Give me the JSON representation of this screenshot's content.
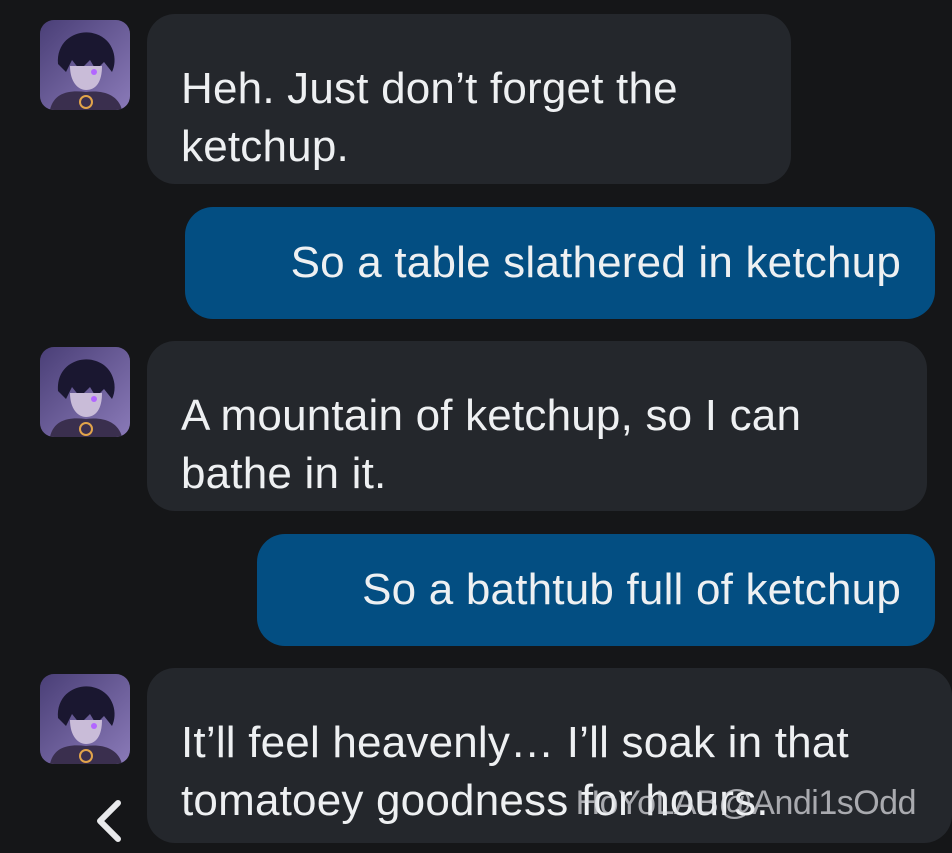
{
  "messages": [
    {
      "sender": "bot",
      "text": "Heh. Just don’t forget the ketchup."
    },
    {
      "sender": "user",
      "text": "So a table slathered in ketchup"
    },
    {
      "sender": "bot",
      "text": "A mountain of ketchup, so I can bathe in it."
    },
    {
      "sender": "user",
      "text": "So a bathtub full of ketchup"
    },
    {
      "sender": "bot",
      "text": "It’ll feel heavenly… I’ll soak in that tomatoey goodness for hours."
    }
  ],
  "watermark": "HoYoLAB@Andi1sOdd",
  "icons": {
    "avatar": "character-avatar",
    "back": "chevron-left-icon"
  },
  "colors": {
    "background": "#151618",
    "incoming_bubble": "#24272c",
    "outgoing_bubble": "#034e82",
    "text": "#eef0f2"
  }
}
